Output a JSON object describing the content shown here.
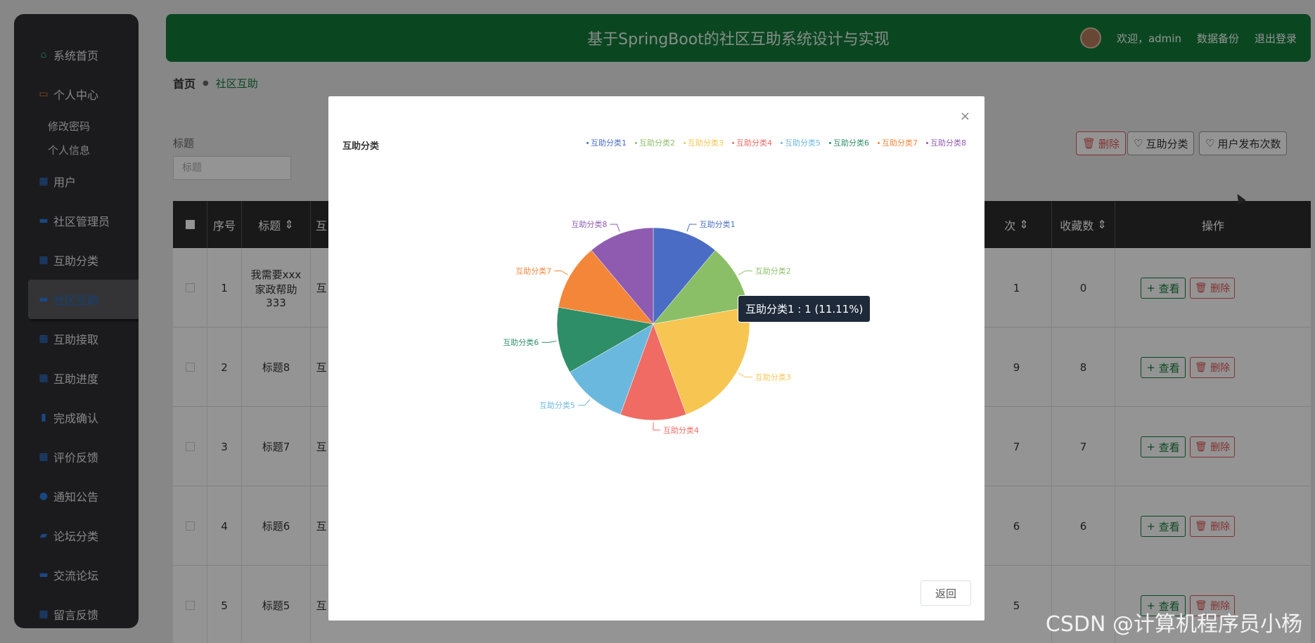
{
  "app": {
    "title": "基于SpringBoot的社区互助系统设计与实现",
    "welcome": "欢迎，admin",
    "backup": "数据备份",
    "logout": "退出登录"
  },
  "sidebar": {
    "items": [
      {
        "label": "系统首页",
        "icon": "home-icon"
      },
      {
        "label": "个人中心",
        "icon": "folder-icon"
      },
      {
        "label": "修改密码",
        "sub": true
      },
      {
        "label": "个人信息",
        "sub": true
      },
      {
        "label": "用户",
        "icon": "grid-icon"
      },
      {
        "label": "社区管理员",
        "icon": "monitor-icon"
      },
      {
        "label": "互助分类",
        "icon": "grid-icon"
      },
      {
        "label": "社区互助",
        "icon": "monitor-icon",
        "active": true
      },
      {
        "label": "互助接取",
        "icon": "grid-icon"
      },
      {
        "label": "互助进度",
        "icon": "grid-icon"
      },
      {
        "label": "完成确认",
        "icon": "bars-icon"
      },
      {
        "label": "评价反馈",
        "icon": "grid-icon"
      },
      {
        "label": "通知公告",
        "icon": "user-icon"
      },
      {
        "label": "论坛分类",
        "icon": "chat-icon"
      },
      {
        "label": "交流论坛",
        "icon": "monitor-icon"
      },
      {
        "label": "留言反馈",
        "icon": "grid-icon"
      }
    ]
  },
  "breadcrumb": {
    "home": "首页",
    "current": "社区互助"
  },
  "filter": {
    "label": "标题",
    "placeholder": "标题"
  },
  "toolbar": {
    "delete": "删除",
    "category": "互助分类",
    "user_count": "用户发布次数"
  },
  "table": {
    "headers": [
      "序号",
      "标题",
      "互",
      "次",
      "收藏数",
      "操作"
    ],
    "rows": [
      {
        "idx": "1",
        "title": "我需要xxx家政帮助333",
        "col3": "互",
        "num1": "1",
        "fav": "0"
      },
      {
        "idx": "2",
        "title": "标题8",
        "col3": "互",
        "num1": "9",
        "fav": "8"
      },
      {
        "idx": "3",
        "title": "标题7",
        "col3": "互",
        "num1": "7",
        "fav": "7"
      },
      {
        "idx": "4",
        "title": "标题6",
        "col3": "互",
        "num1": "6",
        "fav": "6"
      },
      {
        "idx": "5",
        "title": "标题5",
        "col3": "互",
        "num1": "5",
        "fav": ""
      }
    ],
    "view_label": "查看",
    "delete_label": "删除"
  },
  "modal": {
    "close": "×",
    "return_label": "返回"
  },
  "tooltip": "互助分类1 : 1 (11.11%)",
  "watermark": "CSDN @计算机程序员小杨",
  "chart_data": {
    "type": "pie",
    "title": "互助分类",
    "categories": [
      "互助分类1",
      "互助分类2",
      "互助分类3",
      "互助分类4",
      "互助分类5",
      "互助分类6",
      "互助分类7",
      "互助分类8"
    ],
    "values": [
      1,
      1,
      2,
      1,
      1,
      1,
      1,
      1
    ],
    "colors": [
      "#4a6cc4",
      "#8bbf67",
      "#f7c552",
      "#ef6b63",
      "#6bb8de",
      "#2e8e67",
      "#f48639",
      "#8f5bb0"
    ],
    "legend_position": "top-right"
  }
}
